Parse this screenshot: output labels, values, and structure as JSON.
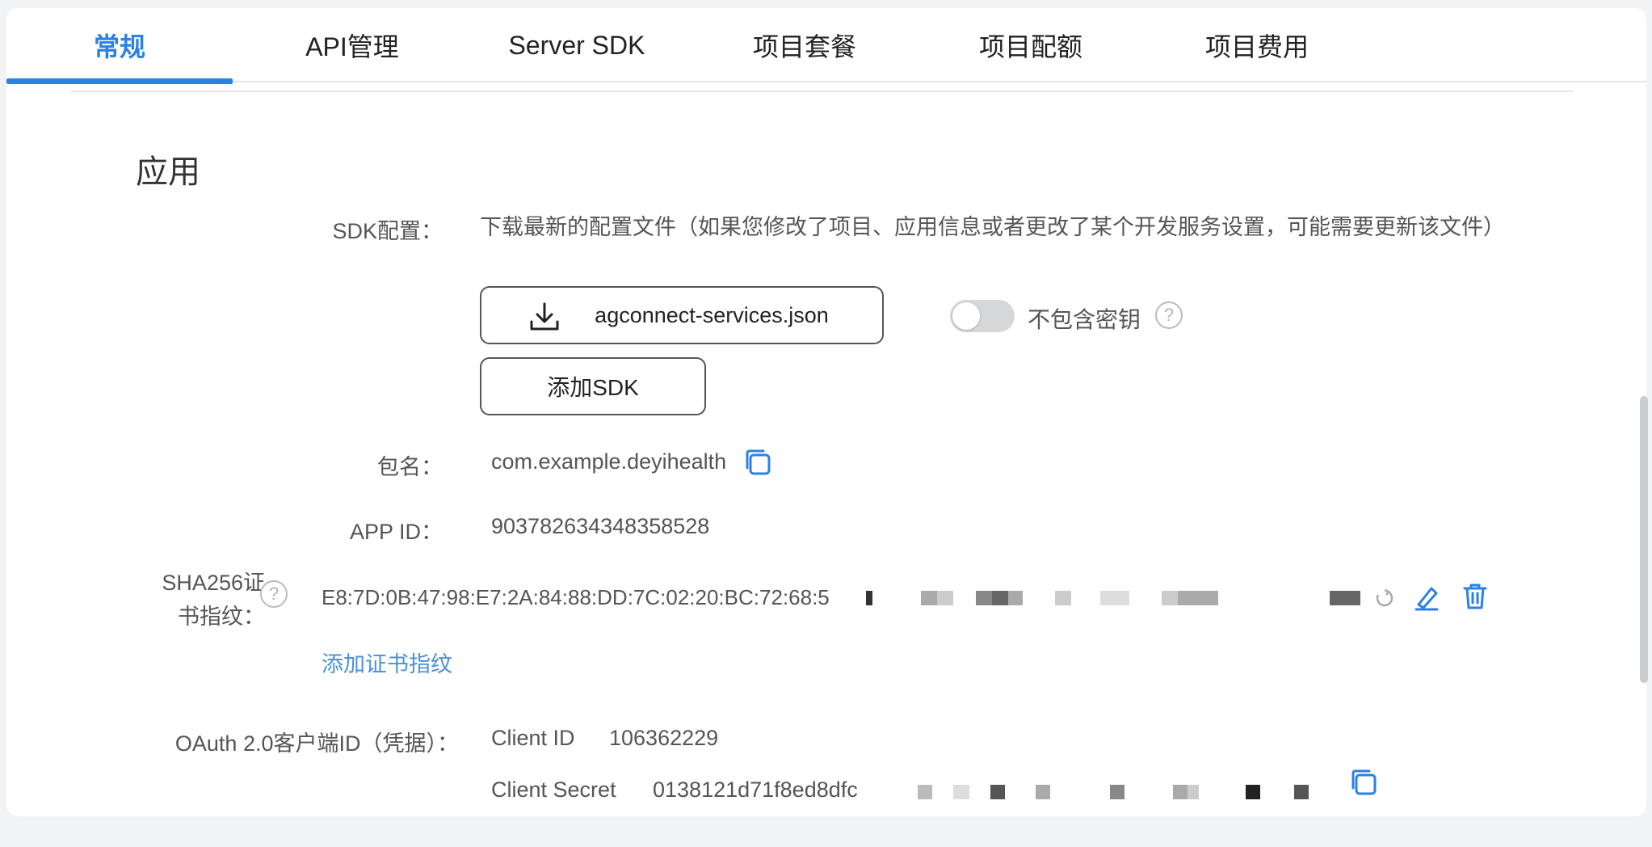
{
  "tabs": [
    {
      "label": "常规",
      "active": true
    },
    {
      "label": "API管理",
      "active": false
    },
    {
      "label": "Server SDK",
      "active": false
    },
    {
      "label": "项目套餐",
      "active": false
    },
    {
      "label": "项目配额",
      "active": false
    },
    {
      "label": "项目费用",
      "active": false
    }
  ],
  "section": {
    "title": "应用"
  },
  "sdk_config": {
    "label": "SDK配置：",
    "description": "下载最新的配置文件（如果您修改了项目、应用信息或者更改了某个开发服务设置，可能需要更新该文件）",
    "download_button": "agconnect-services.json",
    "toggle_label": "不包含密钥",
    "toggle_on": false,
    "add_sdk_button": "添加SDK"
  },
  "package": {
    "label": "包名：",
    "value": "com.example.deyihealth"
  },
  "app_id": {
    "label": "APP ID：",
    "value": "903782634348358528"
  },
  "sha256": {
    "label_line1": "SHA256证",
    "label_line2": "书指纹：",
    "value": "E8:7D:0B:47:98:E7:2A:84:88:DD:7C:02:20:BC:72:68:5",
    "add_link": "添加证书指纹"
  },
  "oauth": {
    "label": "OAuth 2.0客户端ID（凭据）：",
    "client_id_label": "Client ID",
    "client_id_value": "106362229",
    "client_secret_label": "Client Secret",
    "client_secret_value": "0138121d71f8ed8dfc"
  },
  "colors": {
    "accent": "#2a82e4",
    "link": "#4a90d9"
  }
}
